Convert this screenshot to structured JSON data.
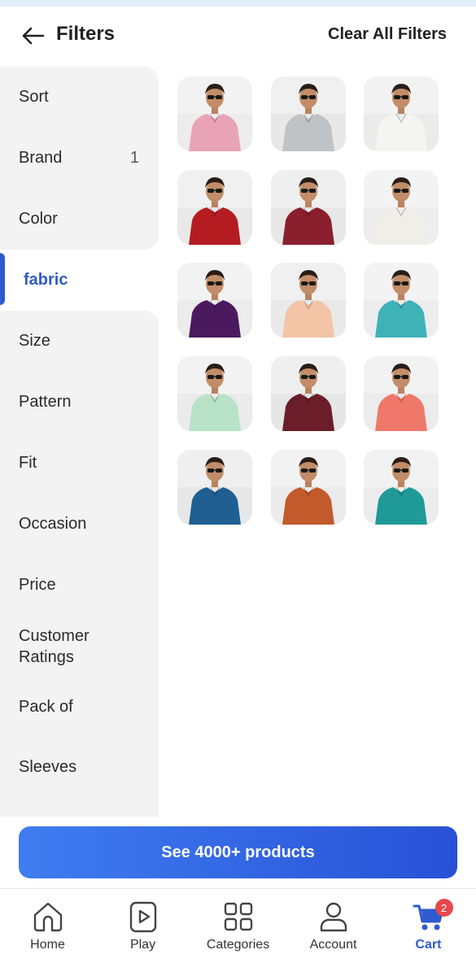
{
  "header": {
    "title": "Filters",
    "clear_all_label": "Clear All Filters"
  },
  "sidebar": {
    "items": [
      {
        "label": "Sort",
        "count": ""
      },
      {
        "label": "Brand",
        "count": "1"
      },
      {
        "label": "Color",
        "count": ""
      },
      {
        "label": "fabric",
        "count": ""
      },
      {
        "label": "Size",
        "count": ""
      },
      {
        "label": "Pattern",
        "count": ""
      },
      {
        "label": "Fit",
        "count": ""
      },
      {
        "label": "Occasion",
        "count": ""
      },
      {
        "label": "Price",
        "count": ""
      },
      {
        "label": "Customer Ratings",
        "count": ""
      },
      {
        "label": "Pack of",
        "count": ""
      },
      {
        "label": "Sleeves",
        "count": ""
      }
    ],
    "active_index": 3
  },
  "products": [
    {
      "shirt": "#e9a3b8",
      "bg": "#ececec"
    },
    {
      "shirt": "#bfc3c6",
      "bg": "#e8e8e8"
    },
    {
      "shirt": "#f4f4f2",
      "bg": "#ebebeb"
    },
    {
      "shirt": "#b51c22",
      "bg": "#e9e9e9"
    },
    {
      "shirt": "#8a1f2e",
      "bg": "#e7e7e7"
    },
    {
      "shirt": "#efefe8",
      "bg": "#ededed"
    },
    {
      "shirt": "#4b1a5e",
      "bg": "#ececec"
    },
    {
      "shirt": "#f3c4a6",
      "bg": "#e9e9e9"
    },
    {
      "shirt": "#3fb2b8",
      "bg": "#ededed"
    },
    {
      "shirt": "#b8e3c8",
      "bg": "#ebebeb"
    },
    {
      "shirt": "#6b1d2a",
      "bg": "#e6e6e6"
    },
    {
      "shirt": "#f0786a",
      "bg": "#ececec"
    },
    {
      "shirt": "#205f92",
      "bg": "#e7e7e7"
    },
    {
      "shirt": "#c25a2b",
      "bg": "#ebebeb"
    },
    {
      "shirt": "#1f9a98",
      "bg": "#ececec"
    }
  ],
  "cta": {
    "label": "See 4000+ products"
  },
  "bottom_nav": {
    "items": [
      {
        "label": "Home",
        "icon": "home-icon"
      },
      {
        "label": "Play",
        "icon": "play-icon"
      },
      {
        "label": "Categories",
        "icon": "categories-icon"
      },
      {
        "label": "Account",
        "icon": "account-icon"
      },
      {
        "label": "Cart",
        "icon": "cart-icon"
      }
    ],
    "active_index": 4,
    "cart_badge": "2"
  },
  "colors": {
    "accent": "#2e5ad0",
    "badge": "#e5484d",
    "sidebar_bg": "#f3f3f3"
  }
}
